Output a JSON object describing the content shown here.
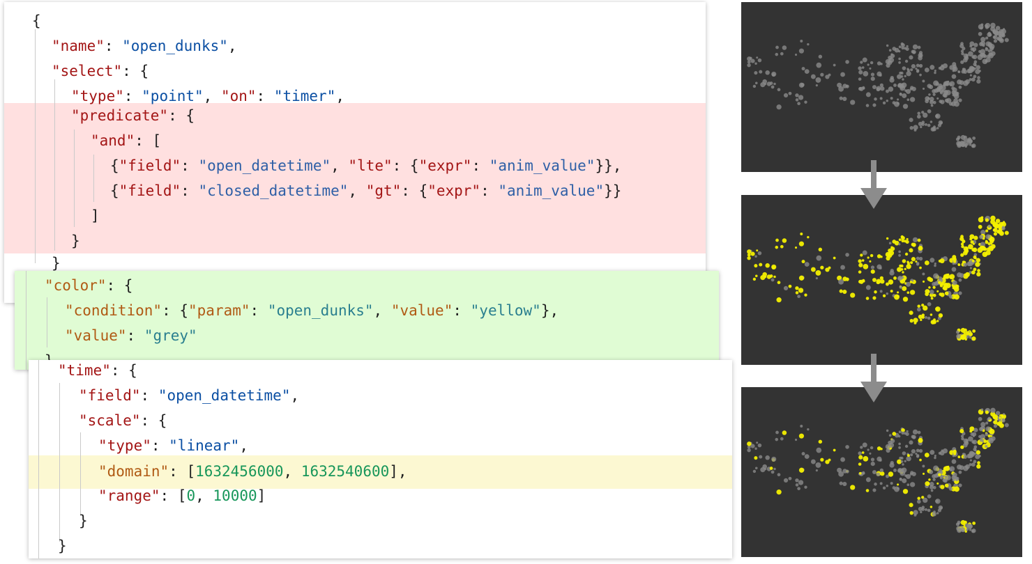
{
  "panel_select": {
    "lines": [
      "{",
      "\"name\": \"open_dunks\",",
      "\"select\": {",
      "\"type\": \"point\", \"on\": \"timer\",",
      "\"predicate\": {",
      "\"and\": [",
      "{\"field\": \"open_datetime\", \"lte\": {\"expr\": \"anim_value\"}},",
      "{\"field\": \"closed_datetime\", \"gt\": {\"expr\": \"anim_value\"}}",
      "]",
      "}",
      "}"
    ],
    "tokens": {
      "name_key": "\"name\"",
      "name_val": "\"open_dunks\"",
      "select_key": "\"select\"",
      "type_key": "\"type\"",
      "type_val": "\"point\"",
      "on_key": "\"on\"",
      "on_val": "\"timer\"",
      "predicate_key": "\"predicate\"",
      "and_key": "\"and\"",
      "field_key": "\"field\"",
      "open_datetime": "\"open_datetime\"",
      "lte_key": "\"lte\"",
      "expr_key": "\"expr\"",
      "anim_value": "\"anim_value\"",
      "closed_datetime": "\"closed_datetime\"",
      "gt_key": "\"gt\""
    }
  },
  "panel_color": {
    "tokens": {
      "color_key": "\"color\"",
      "condition_key": "\"condition\"",
      "param_key": "\"param\"",
      "param_val": "\"open_dunks\"",
      "value_key": "\"value\"",
      "yellow_val": "\"yellow\"",
      "grey_val": "\"grey\""
    }
  },
  "panel_time": {
    "tokens": {
      "time_key": "\"time\"",
      "field_key": "\"field\"",
      "field_val": "\"open_datetime\"",
      "scale_key": "\"scale\"",
      "type_key": "\"type\"",
      "type_val": "\"linear\"",
      "domain_key": "\"domain\"",
      "domain_start": "1632456000",
      "domain_end": "1632540600",
      "range_key": "\"range\"",
      "range_start": "0",
      "range_end": "10000"
    }
  },
  "colors": {
    "predicate_highlight": "#ffe0e0",
    "color_highlight": "#e0fcd4",
    "domain_highlight": "#fcf8d2",
    "thumb_background": "#333333",
    "grey_point": "#8a8a8a",
    "yellow_point": "#f4f000",
    "arrow": "#8c8c8c"
  },
  "thumbnails": [
    {
      "name": "map-before",
      "highlighted_share": 0.0
    },
    {
      "name": "map-middle",
      "highlighted_share": 0.75
    },
    {
      "name": "map-after",
      "highlighted_share": 0.25
    }
  ]
}
